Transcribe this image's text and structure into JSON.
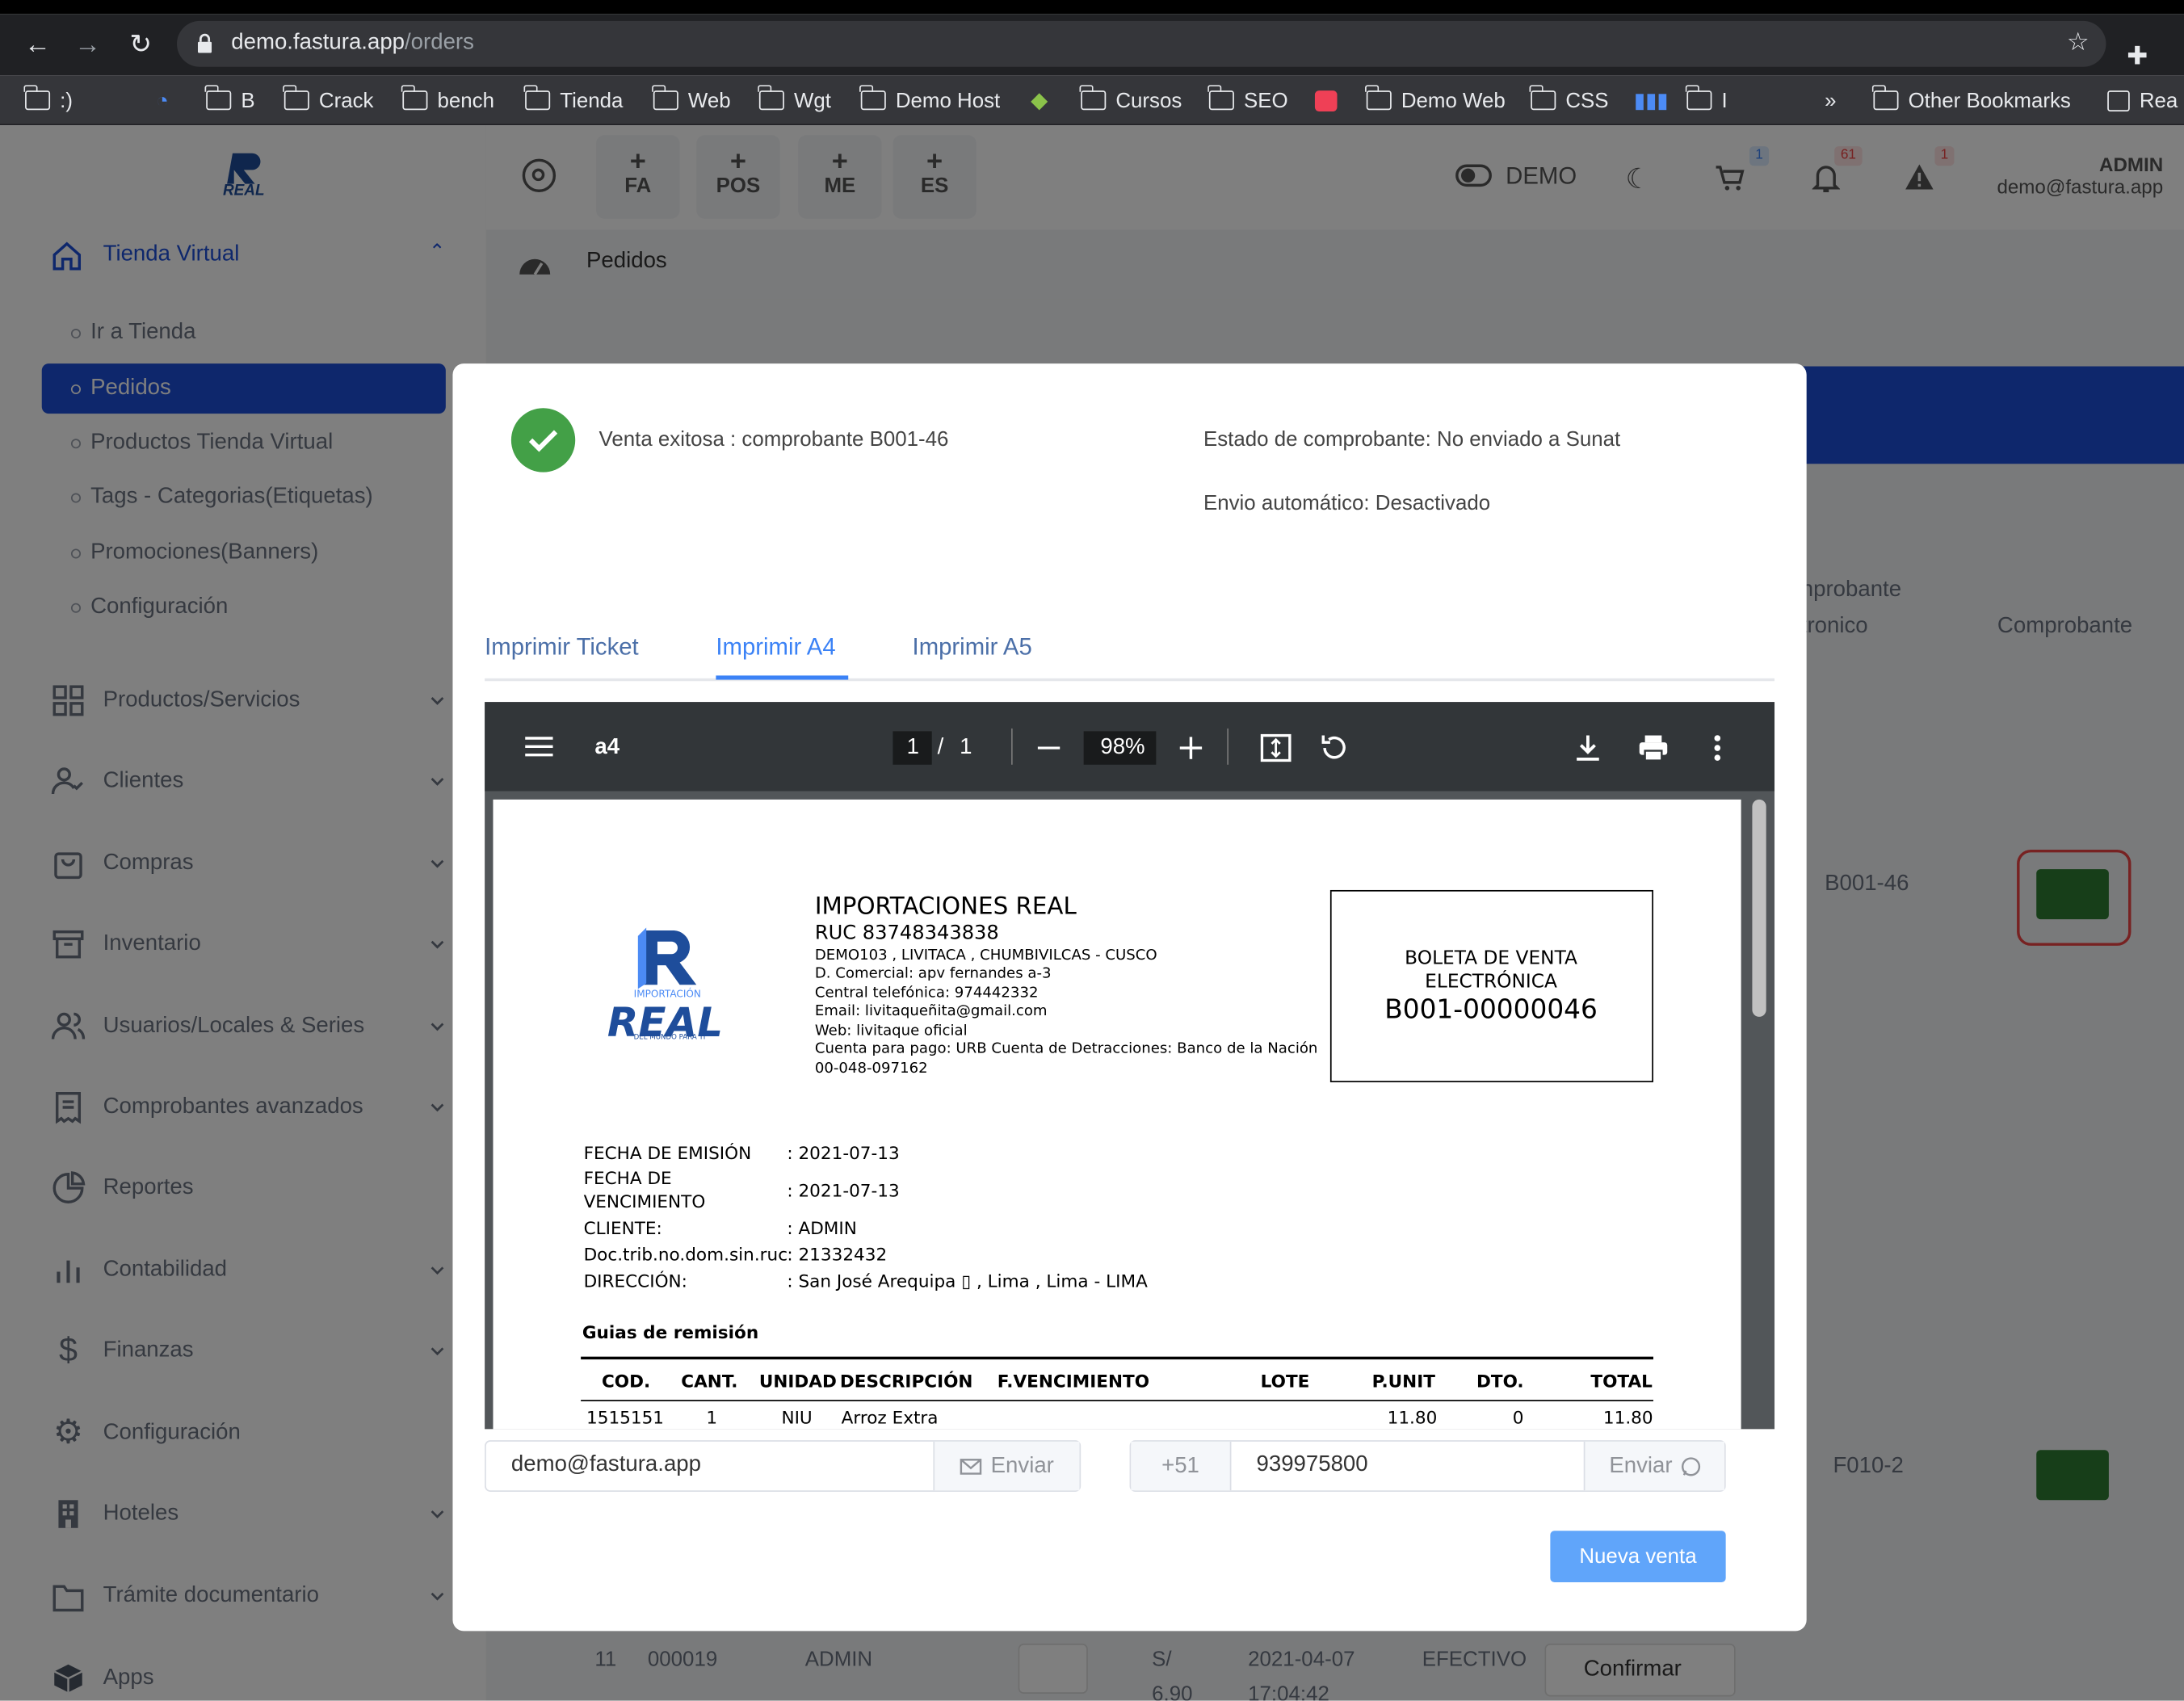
{
  "browser": {
    "url_host": "demo.fastura.app",
    "url_path": "/orders",
    "bookmarks": [
      ":)",
      "B",
      "Crack",
      "bench",
      "Tienda",
      "Web",
      "Wgt",
      "Demo Host",
      "Cursos",
      "SEO",
      "Demo Web",
      "CSS",
      "I"
    ],
    "bookmarks_overflow": "»",
    "other_bookmarks": "Other Bookmarks",
    "reading_list": "Rea"
  },
  "topbar": {
    "quick_buttons": [
      "FA",
      "POS",
      "ME",
      "ES"
    ],
    "demo_label": "DEMO",
    "cart_badge": "1",
    "bell_badge": "61",
    "alert_badge": "1",
    "user_name": "ADMIN",
    "user_email": "demo@fastura.app"
  },
  "breadcrumb": {
    "title": "Pedidos"
  },
  "sidebar": {
    "open_section": "Tienda Virtual",
    "sub_items": [
      "Ir a Tienda",
      "Pedidos",
      "Productos Tienda Virtual",
      "Tags - Categorias(Etiquetas)",
      "Promociones(Banners)",
      "Configuración"
    ],
    "items": [
      "Productos/Servicios",
      "Clientes",
      "Compras",
      "Inventario",
      "Usuarios/Locales & Series",
      "Comprobantes avanzados",
      "Reportes",
      "Contabilidad",
      "Finanzas",
      "Configuración",
      "Hoteles",
      "Trámite documentario",
      "Apps"
    ]
  },
  "background_table": {
    "col_comprobante_electronico_1": "nprobante",
    "col_comprobante_electronico_2": "tronico",
    "col_comprobante": "Comprobante",
    "row1_series": "B001-46",
    "row2_series": "F010-2",
    "bottom_row": {
      "num": "11",
      "code": "000019",
      "user": "ADMIN",
      "amount_1": "S/",
      "amount_2": "6.90",
      "date": "2021-04-07",
      "time": "17:04:42",
      "payment": "EFECTIVO",
      "status": "Confirmar"
    }
  },
  "modal": {
    "success_text": "Venta exitosa : comprobante B001-46",
    "status_text": "Estado de comprobante: No enviado a Sunat",
    "auto_send_text": "Envio automático: Desactivado",
    "tabs": [
      "Imprimir Ticket",
      "Imprimir A4",
      "Imprimir A5"
    ],
    "active_tab": "Imprimir A4",
    "pdf_viewer": {
      "doc_name": "a4",
      "page_current": "1",
      "page_sep": "/",
      "page_total": "1",
      "zoom": "98%"
    },
    "document": {
      "logo_top": "IMPORTACIÓN",
      "logo_main": "REAL",
      "logo_tagline": "DEL MUNDO PARA TI",
      "company": "IMPORTACIONES REAL",
      "ruc": "RUC 83748343838",
      "address": "DEMO103 , LIVITACA , CHUMBIVILCAS - CUSCO",
      "commercial": "D. Comercial: apv fernandes a-3",
      "phone": "Central telefónica: 974442332",
      "email": "Email: livitaqueñita@gmail.com",
      "web": "Web: livitaque oficial",
      "account": "Cuenta para pago: URB Cuenta de Detracciones: Banco de la Nación",
      "account_num": "00-048-097162",
      "box_line1": "BOLETA DE VENTA",
      "box_line2": "ELECTRÓNICA",
      "box_number": "B001-00000046",
      "fields": [
        {
          "label": "FECHA DE EMISIÓN",
          "value": ": 2021-07-13"
        },
        {
          "label": "FECHA DE",
          "label2": "VENCIMIENTO",
          "value": ": 2021-07-13"
        },
        {
          "label": "CLIENTE:",
          "value": ": ADMIN"
        },
        {
          "label": "Doc.trib.no.dom.sin.ruc",
          "value": ": 21332432"
        },
        {
          "label": "DIRECCIÓN:",
          "value": ": San José Arequipa ▯ , Lima , Lima - LIMA"
        }
      ],
      "guias_title": "Guias de remisión",
      "table_headers": [
        "COD.",
        "CANT.",
        "UNIDAD",
        "DESCRIPCIÓN",
        "F.VENCIMIENTO",
        "LOTE",
        "P.UNIT",
        "DTO.",
        "TOTAL"
      ],
      "table_rows": [
        [
          "1515151",
          "1",
          "NIU",
          "Arroz Extra",
          "",
          "",
          "11.80",
          "0",
          "11.80"
        ]
      ]
    },
    "email_value": "demo@fastura.app",
    "email_send": "Enviar",
    "phone_prefix": "+51",
    "phone_value": "939975800",
    "phone_send": "Enviar",
    "new_sale": "Nueva venta"
  },
  "colors": {
    "primary": "#1d4ed8",
    "success": "#43a047",
    "tab_active": "#3b82f6",
    "new_sale_button": "#60a5fa"
  }
}
